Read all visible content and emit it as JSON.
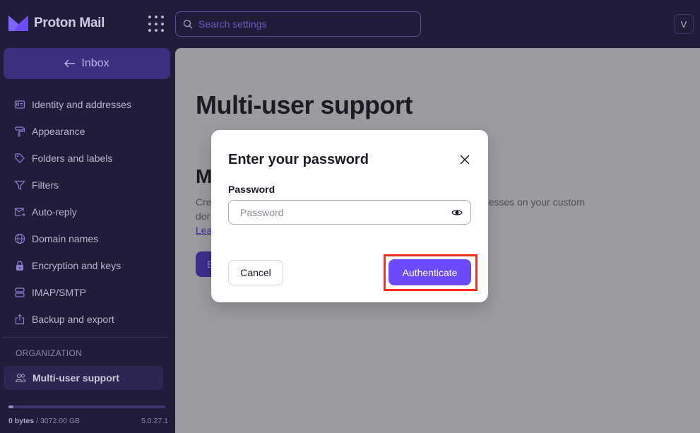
{
  "app": {
    "brand": "Proton Mail",
    "avatar_initial": "V"
  },
  "search": {
    "placeholder": "Search settings",
    "value": ""
  },
  "sidebar": {
    "inbox_label": "Inbox",
    "items": [
      {
        "label": "Identity and addresses",
        "icon": "id-card-icon"
      },
      {
        "label": "Appearance",
        "icon": "paint-roller-icon"
      },
      {
        "label": "Folders and labels",
        "icon": "tag-icon"
      },
      {
        "label": "Filters",
        "icon": "filter-icon"
      },
      {
        "label": "Auto-reply",
        "icon": "envelope-arrow-icon"
      },
      {
        "label": "Domain names",
        "icon": "globe-icon"
      },
      {
        "label": "Encryption and keys",
        "icon": "lock-icon"
      },
      {
        "label": "IMAP/SMTP",
        "icon": "servers-icon"
      },
      {
        "label": "Backup and export",
        "icon": "export-icon"
      }
    ],
    "section_title": "ORGANIZATION",
    "active_item": {
      "label": "Multi-user support",
      "icon": "users-icon"
    },
    "storage": {
      "used": "0 bytes",
      "separator": " / ",
      "total": "3072.00 GB",
      "used_fraction": 0.0
    },
    "version": "5.0.27.1"
  },
  "main": {
    "page_title": "Multi-user support",
    "section_heading": "M",
    "section_desc_left": "Cre",
    "section_desc_left2": "dor",
    "section_desc_right": "esses on your custom",
    "learn_link": "Lea",
    "enable_button": "E"
  },
  "modal": {
    "title": "Enter your password",
    "field_label": "Password",
    "password_placeholder": "Password",
    "password_value": "",
    "cancel_label": "Cancel",
    "authenticate_label": "Authenticate"
  },
  "colors": {
    "sidebar_bg": "#201d3a",
    "accent": "#6d4aff",
    "highlight_box": "#ff2a1a"
  }
}
